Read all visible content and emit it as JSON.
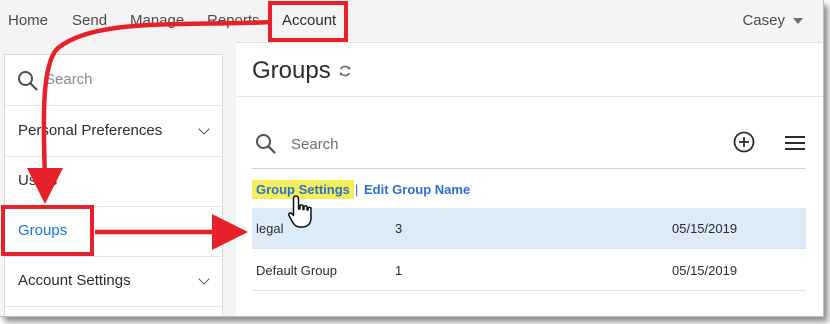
{
  "nav": {
    "items": [
      "Home",
      "Send",
      "Manage",
      "Reports",
      "Account"
    ],
    "user": "Casey"
  },
  "sidebar": {
    "search_placeholder": "Search",
    "items": [
      {
        "label": "Personal Preferences",
        "expandable": true
      },
      {
        "label": "Users",
        "expandable": false
      },
      {
        "label": "Groups",
        "expandable": false,
        "active": true
      },
      {
        "label": "Account Settings",
        "expandable": true
      }
    ]
  },
  "main": {
    "title": "Groups",
    "search_placeholder": "Search",
    "actions": {
      "group_settings": "Group Settings",
      "separator": "|",
      "edit_group_name": "Edit Group Name"
    },
    "rows": [
      {
        "name": "legal",
        "count": "3",
        "date": "05/15/2019",
        "selected": true
      },
      {
        "name": "Default Group",
        "count": "1",
        "date": "05/15/2019",
        "selected": false
      }
    ]
  },
  "colors": {
    "annotation_red": "#e8202a",
    "highlight_yellow": "#f4ee59",
    "link_blue": "#2c6fd1",
    "active_blue": "#1473e6",
    "selected_row": "#ddeaf8"
  },
  "icons": [
    "search-icon",
    "refresh-icon",
    "add-circle-icon",
    "hamburger-menu-icon",
    "chevron-down-icon",
    "pointer-hand-cursor-icon"
  ]
}
